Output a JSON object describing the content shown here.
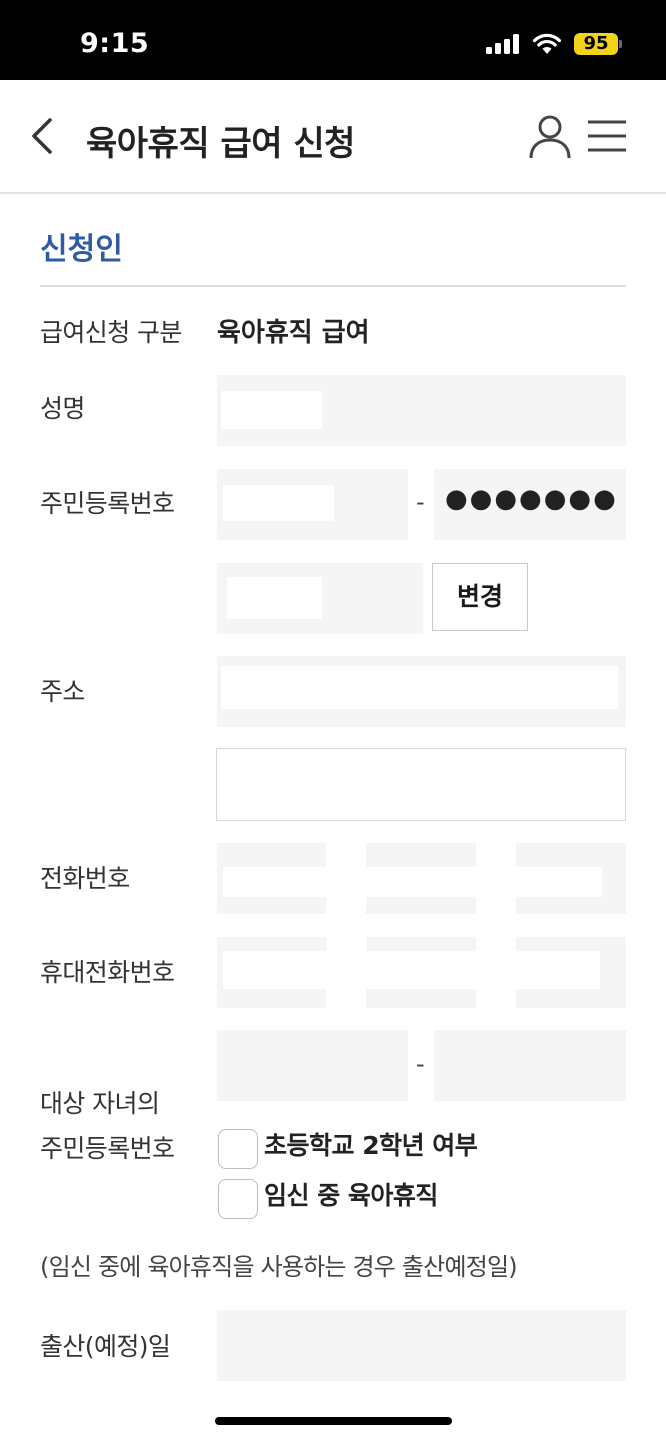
{
  "status": {
    "time": "9:15",
    "battery": "95"
  },
  "header": {
    "title": "육아휴직 급여 신청"
  },
  "section": {
    "title": "신청인"
  },
  "form": {
    "benefit_type_label": "급여신청 구분",
    "benefit_type_value": "육아휴직 급여",
    "name_label": "성명",
    "rrn_label": "주민등록번호",
    "rrn_separator": "-",
    "rrn_masked": "●●●●●●●",
    "change_button": "변경",
    "address_label": "주소",
    "phone_label": "전화번호",
    "mobile_label": "휴대전화번호",
    "child_rrn_label_line1": "대상 자녀의",
    "child_rrn_label_line2": "주민등록번호",
    "child_rrn_separator": "-",
    "checkbox_elementary": "초등학교 2학년 여부",
    "checkbox_pregnancy": "임신 중 육아휴직",
    "pregnancy_note": "(임신 중에 육아휴직을 사용하는 경우 출산예정일)",
    "due_date_label": "출산(예정)일"
  }
}
